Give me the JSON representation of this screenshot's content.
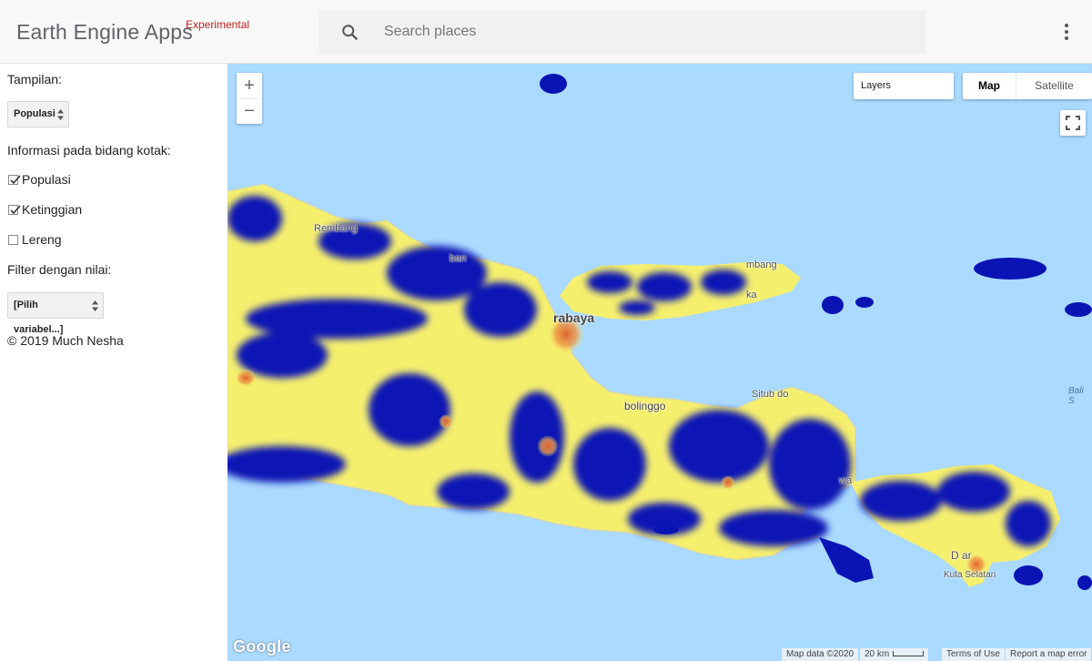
{
  "header": {
    "title": "Earth Engine Apps",
    "badge": "Experimental",
    "search_placeholder": "Search places",
    "search_icon": "search-icon",
    "menu_icon": "more-vert-icon"
  },
  "panel": {
    "display_label": "Tampilan:",
    "display_select": "Populasi",
    "grid_info_label": "Informasi pada bidang kotak:",
    "checkboxes": [
      {
        "label": "Populasi",
        "checked": true
      },
      {
        "label": "Ketinggian",
        "checked": true
      },
      {
        "label": "Lereng",
        "checked": false
      }
    ],
    "filter_label": "Filter dengan nilai:",
    "filter_select": "[Pilih variabel...]",
    "copyright": "© 2019 Much Nesha"
  },
  "map": {
    "zoom_in": "+",
    "zoom_out": "−",
    "layers_label": "Layers",
    "map_type_map": "Map",
    "map_type_satellite": "Satellite",
    "google_logo": "Google",
    "attribution": "Map data ©2020",
    "scale_label": "20 km",
    "terms": "Terms of Use",
    "report": "Report a map error",
    "labels": {
      "rembang": "Rembang",
      "tuban": "ban",
      "surabaya": "rabaya",
      "sumenep": "mbang",
      "probolinggo": "bolinggo",
      "situbondo": "Situb    do",
      "denpasar": "D        ar",
      "kuta": "Kuta Selatan",
      "bali_sea": "Bali S",
      "ka": "ka",
      "wa": "wa"
    },
    "colors": {
      "sea": "#aadaff",
      "low": "#0a14b4",
      "mid": "#f5ef6e",
      "high": "#e0652a"
    }
  }
}
